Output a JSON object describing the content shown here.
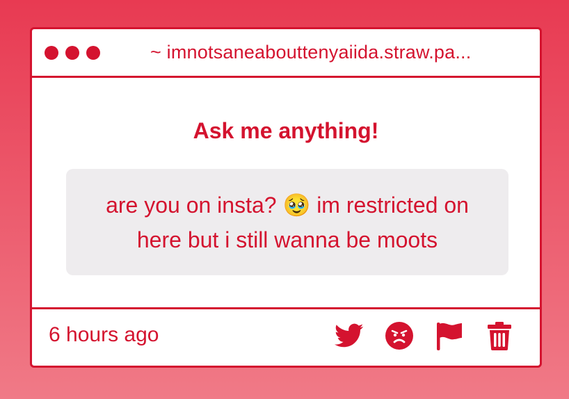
{
  "window": {
    "url": "~ imnotsaneabouttenyaiida.straw.pa..."
  },
  "card": {
    "heading": "Ask me anything!",
    "message": "are you on insta? 🥹 im restricted on here but i still wanna be moots",
    "timestamp": "6 hours ago"
  },
  "actions": [
    {
      "icon": "twitter-icon"
    },
    {
      "icon": "angry-face-icon"
    },
    {
      "icon": "flag-icon"
    },
    {
      "icon": "trash-icon"
    }
  ],
  "colors": {
    "accent": "#d4132f",
    "background_top": "#e83a52",
    "background_bottom": "#f07a87",
    "bubble": "#eeecee"
  }
}
